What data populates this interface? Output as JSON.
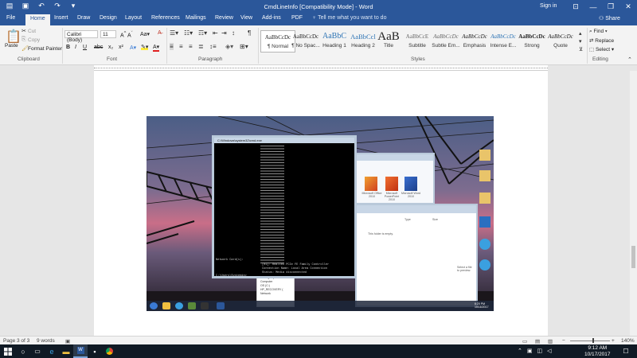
{
  "titlebar": {
    "document_title": "CmdLineInfo [Compatibility Mode]  -  Word",
    "sign_in": "Sign in"
  },
  "tabs": [
    "File",
    "Home",
    "Insert",
    "Draw",
    "Design",
    "Layout",
    "References",
    "Mailings",
    "Review",
    "View",
    "Add-ins",
    "PDF"
  ],
  "tell_me": "Tell me what you want to do",
  "share": "Share",
  "clipboard": {
    "paste": "Paste",
    "cut": "Cut",
    "copy": "Copy",
    "format_painter": "Format Painter",
    "group": "Clipboard"
  },
  "font": {
    "name": "Calibri (Body)",
    "size": "11",
    "group": "Font"
  },
  "paragraph": {
    "group": "Paragraph"
  },
  "styles": {
    "group": "Styles",
    "items": [
      {
        "preview": "AaBbCcDc",
        "name": "¶ Normal"
      },
      {
        "preview": "AaBbCcDc",
        "name": "¶ No Spac..."
      },
      {
        "preview": "AaBbC",
        "name": "Heading 1"
      },
      {
        "preview": "AaBbCcl",
        "name": "Heading 2"
      },
      {
        "preview": "AaB",
        "name": "Title"
      },
      {
        "preview": "AaBbCcE",
        "name": "Subtitle"
      },
      {
        "preview": "AaBbCcDc",
        "name": "Subtle Em..."
      },
      {
        "preview": "AaBbCcDc",
        "name": "Emphasis"
      },
      {
        "preview": "AaBbCcDc",
        "name": "Intense E..."
      },
      {
        "preview": "AaBbCcDc",
        "name": "Strong"
      },
      {
        "preview": "AaBbCcDc",
        "name": "Quote"
      }
    ]
  },
  "editing": {
    "find": "Find",
    "replace": "Replace",
    "select": "Select",
    "group": "Editing"
  },
  "embedded": {
    "cmd_title": "C:\\Windows\\system32\\cmd.exe",
    "cmd_lines": [
      "Network Card(s):",
      "[01]: Realtek PCIe FE Family Controller",
      "Connection Name: Local Area Connection",
      "Status:          Media disconnected",
      "C:\\Users\\Systemin>_"
    ],
    "folder_empty": "This folder is empty.",
    "type_col": "Type",
    "size_col": "Size",
    "preview": "Select a file to preview.",
    "apps": [
      "Microsoft Office 2010",
      "Microsoft PowerPoint 2010",
      "Microsoft Word 2010"
    ],
    "tree": [
      "Homegroup",
      "Computer",
      "OS (C:)",
      "HP_RECOVERY (",
      "Network"
    ],
    "clock_time": "6:20 PM",
    "clock_date": "10/16/2017"
  },
  "status": {
    "page": "Page 3 of 3",
    "words": "9 words",
    "zoom": "140%"
  },
  "taskbar": {
    "time": "9:12 AM",
    "date": "10/17/2017"
  }
}
